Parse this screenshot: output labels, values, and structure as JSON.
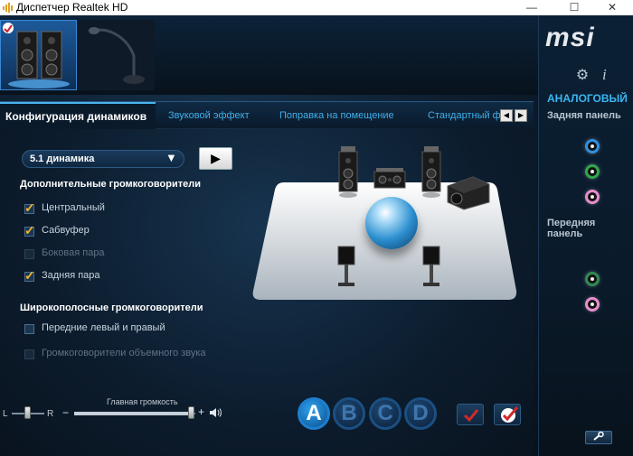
{
  "window": {
    "title": "Диспетчер Realtek HD",
    "minimize_glyph": "—",
    "maximize_glyph": "☐",
    "close_glyph": "✕"
  },
  "devices": [
    {
      "name": "speakers",
      "selected": true
    },
    {
      "name": "microphone",
      "selected": false
    }
  ],
  "tabs": {
    "active": "Конфигурация динамиков",
    "items": [
      "Звуковой эффект",
      "Поправка на помещение",
      "Стандартный ф"
    ]
  },
  "config": {
    "selected_value": "5.1 динамика",
    "arrow_glyph": "▼",
    "play_glyph": "▶"
  },
  "sections": {
    "optional_title": "Дополнительные громкоговорители",
    "optional_items": [
      {
        "label": "Центральный",
        "checked": true,
        "enabled": true
      },
      {
        "label": "Сабвуфер",
        "checked": true,
        "enabled": true
      },
      {
        "label": "Боковая пара",
        "checked": false,
        "enabled": false
      },
      {
        "label": "Задняя пара",
        "checked": true,
        "enabled": true
      }
    ],
    "fullrange_title": "Широкополосные громкоговорители",
    "fullrange_items": [
      {
        "label": "Передние левый и правый",
        "checked": false,
        "enabled": true
      },
      {
        "label": "Громкоговорители объемного звука",
        "checked": false,
        "enabled": false
      }
    ]
  },
  "volume": {
    "title": "Главная громкость",
    "left_label": "L",
    "right_label": "R",
    "minus_glyph": "−",
    "plus_glyph": "+",
    "level": 0.97,
    "balance": 0.5
  },
  "profiles": [
    "A",
    "B",
    "C",
    "D"
  ],
  "active_profile": "A",
  "right_panel": {
    "brand": "msi",
    "analog_label": "АНАЛОГОВЫЙ",
    "back_panel_label": "Задняя панель",
    "front_panel_label": "Передняя панель",
    "back_jacks": [
      "#2f8fe0",
      "#2fa84a",
      "#e88ccf"
    ],
    "front_jacks": [
      "#2f8a52",
      "#e88ccf"
    ],
    "wrench_glyph": "🔧"
  },
  "colors": {
    "accent": "#3fb0ec",
    "checkmark": "#f1b628"
  }
}
